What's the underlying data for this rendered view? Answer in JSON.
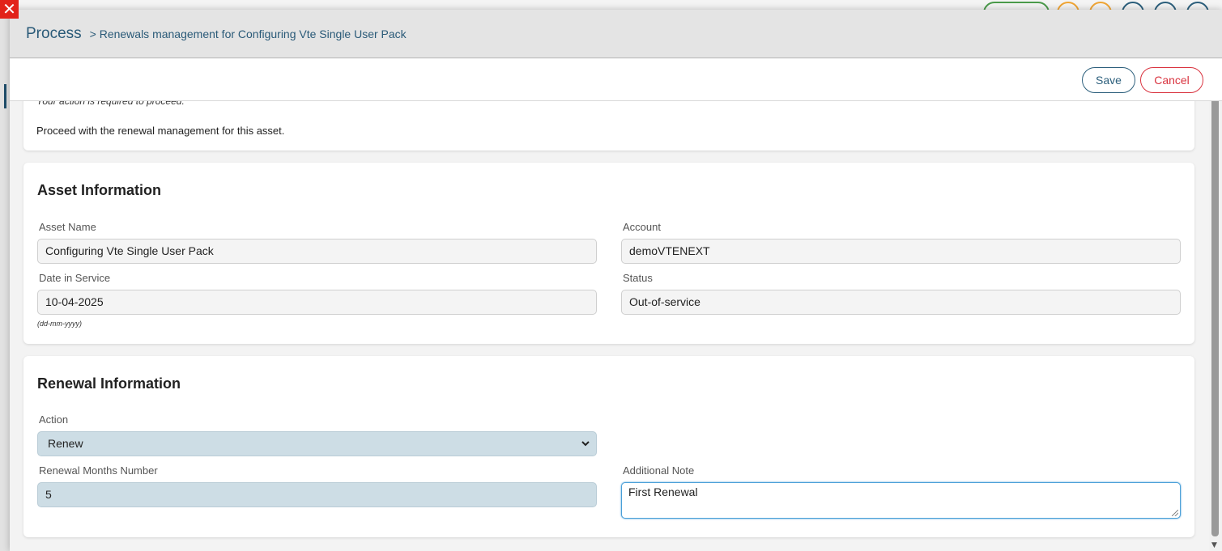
{
  "close_icon_glyph": "✕",
  "header": {
    "title": "Process",
    "breadcrumb": "> Renewals management for Configuring Vte Single User Pack"
  },
  "toolbar": {
    "save_label": "Save",
    "cancel_label": "Cancel"
  },
  "message": {
    "required_text": "Your action is required to proceed.",
    "instruction": "Proceed with the renewal management for this asset."
  },
  "asset_info": {
    "title": "Asset Information",
    "asset_name_label": "Asset Name",
    "asset_name_value": "Configuring Vte Single User Pack",
    "account_label": "Account",
    "account_value": "demoVTENEXT",
    "date_label": "Date in Service",
    "date_value": "10-04-2025",
    "date_hint": "(dd-mm-yyyy)",
    "status_label": "Status",
    "status_value": "Out-of-service"
  },
  "renewal_info": {
    "title": "Renewal Information",
    "action_label": "Action",
    "action_value": "Renew",
    "months_label": "Renewal Months Number",
    "months_value": "5",
    "note_label": "Additional Note",
    "note_value": "First Renewal"
  },
  "colors": {
    "accent": "#2c5f7c",
    "danger": "#d9333f",
    "close": "#e2231a",
    "field_editable": "#cddde5"
  }
}
